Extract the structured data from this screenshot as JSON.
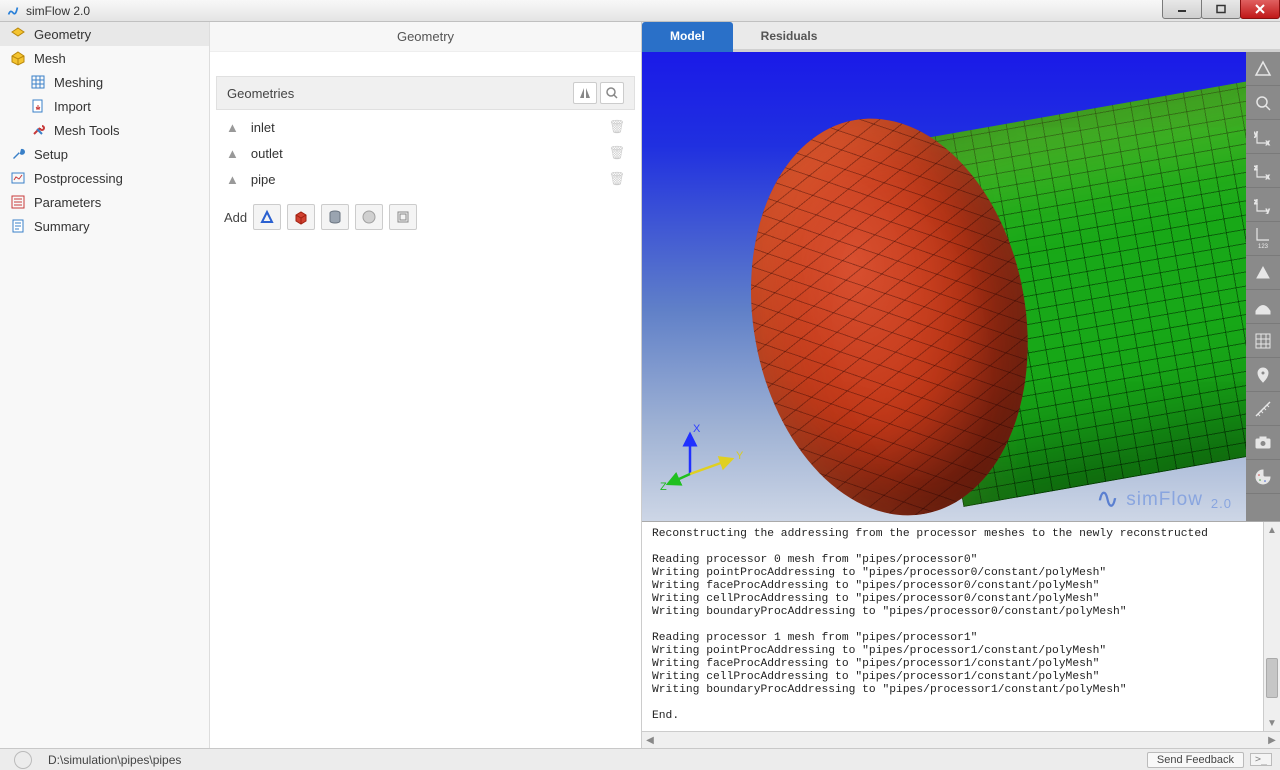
{
  "window": {
    "title": "simFlow 2.0"
  },
  "sidebar": {
    "items": [
      {
        "label": "Geometry"
      },
      {
        "label": "Mesh"
      },
      {
        "label": "Meshing"
      },
      {
        "label": "Import"
      },
      {
        "label": "Mesh Tools"
      },
      {
        "label": "Setup"
      },
      {
        "label": "Postprocessing"
      },
      {
        "label": "Parameters"
      },
      {
        "label": "Summary"
      }
    ]
  },
  "mid": {
    "title": "Geometry",
    "section_label": "Geometries",
    "items": [
      {
        "name": "inlet"
      },
      {
        "name": "outlet"
      },
      {
        "name": "pipe"
      }
    ],
    "add_label": "Add"
  },
  "viewer": {
    "tabs": [
      {
        "label": "Model",
        "active": true
      },
      {
        "label": "Residuals",
        "active": false
      }
    ],
    "watermark_main": "simFlow",
    "watermark_ver": "2.0",
    "axes": {
      "x": "X",
      "y": "Y",
      "z": "Z"
    },
    "side_labels": {
      "yx": "y\nx",
      "zx": "z\nx",
      "zy": "z\ny",
      "nums": "123"
    }
  },
  "console_text": "Reconstructing the addressing from the processor meshes to the newly reconstructed\n\nReading processor 0 mesh from \"pipes/processor0\"\nWriting pointProcAddressing to \"pipes/processor0/constant/polyMesh\"\nWriting faceProcAddressing to \"pipes/processor0/constant/polyMesh\"\nWriting cellProcAddressing to \"pipes/processor0/constant/polyMesh\"\nWriting boundaryProcAddressing to \"pipes/processor0/constant/polyMesh\"\n\nReading processor 1 mesh from \"pipes/processor1\"\nWriting pointProcAddressing to \"pipes/processor1/constant/polyMesh\"\nWriting faceProcAddressing to \"pipes/processor1/constant/polyMesh\"\nWriting cellProcAddressing to \"pipes/processor1/constant/polyMesh\"\nWriting boundaryProcAddressing to \"pipes/processor1/constant/polyMesh\"\n\nEnd.",
  "status": {
    "path": "D:\\simulation\\pipes\\pipes",
    "feedback": "Send Feedback"
  }
}
